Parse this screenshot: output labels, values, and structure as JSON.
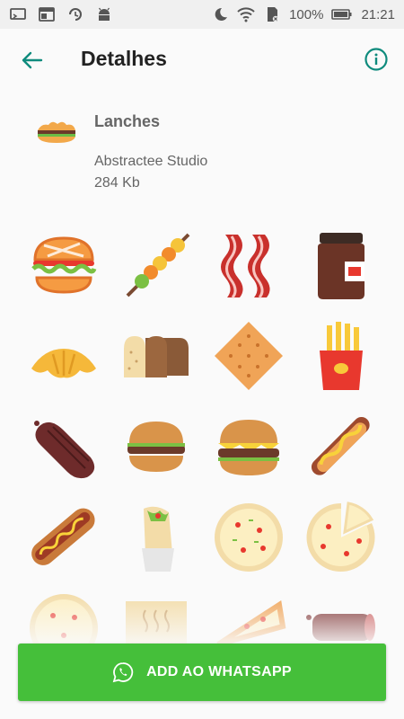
{
  "status_bar": {
    "battery": "100%",
    "time": "21:21",
    "left_icons": [
      "screen-cast-icon",
      "browser-icon",
      "sync-icon",
      "android-icon"
    ],
    "right_icons": [
      "moon-icon",
      "wifi-icon",
      "sd-card-icon",
      "battery-icon"
    ]
  },
  "header": {
    "title": "Detalhes",
    "back_icon": "arrow-left-icon",
    "info_icon": "info-icon"
  },
  "pack": {
    "name": "Lanches",
    "author": "Abstractee Studio",
    "size": "284 Kb"
  },
  "stickers": [
    "burger",
    "kebab",
    "bacon",
    "chocolate-jar",
    "croissant",
    "bread-loaf",
    "cracker",
    "french-fries",
    "salami",
    "burger-small",
    "cheeseburger",
    "hotdog-mustard",
    "hotdog",
    "burrito",
    "pizza",
    "pizza-slice-cut",
    "pizza-partial",
    "pizza-box",
    "pizza-slice",
    "sausage"
  ],
  "cta": {
    "label": "ADD AO WHATSAPP",
    "icon": "whatsapp-icon"
  },
  "colors": {
    "accent": "#009688",
    "button": "#45bf3a"
  }
}
